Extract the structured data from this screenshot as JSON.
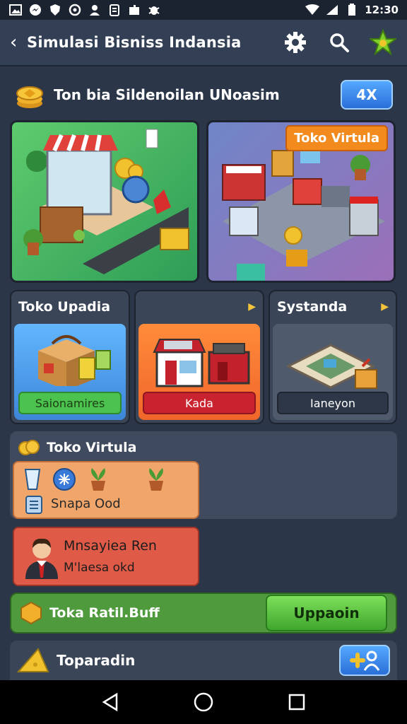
{
  "status_bar": {
    "time": "12:30",
    "icons": [
      "image-icon",
      "messenger-icon",
      "shield-icon",
      "sync-icon",
      "people-icon",
      "clipboard-icon",
      "puzzle-icon",
      "bug-icon",
      "wifi-icon",
      "signal-icon",
      "battery-icon"
    ]
  },
  "top_bar": {
    "title": "Simulasi Bisniss Indansia",
    "back_icon": "chevron-left-icon",
    "settings_icon": "gear-icon",
    "search_icon": "search-icon",
    "star_icon": "star-icon"
  },
  "header": {
    "title": "Ton bia Sildenoilan UNoasim",
    "speed_button": "4X"
  },
  "cards": {
    "virtual_tag": "Toko Virtula"
  },
  "categories": [
    {
      "title": "Toko Upadia",
      "button": "Saionamires",
      "chevron": false
    },
    {
      "title": "",
      "button": "Kada",
      "chevron": true
    },
    {
      "title": "Systanda",
      "button": "Ianeyon",
      "chevron": true
    }
  ],
  "section": {
    "title": "Toko Virtula",
    "item_orange_label": "Snapa Ood",
    "item_red_name": "Mnsayiea Ren",
    "item_red_sub": "M'laesa okd"
  },
  "green_bar": {
    "text": "Toka Ratil.Buff",
    "button": "Uppaoin"
  },
  "bottom_row": {
    "text": "Toparadin"
  },
  "colors": {
    "background": "#2b3648",
    "accent_blue": "#2a6fd8",
    "accent_green": "#4cc24f",
    "accent_orange": "#f28a1e",
    "accent_red": "#c8232f"
  }
}
